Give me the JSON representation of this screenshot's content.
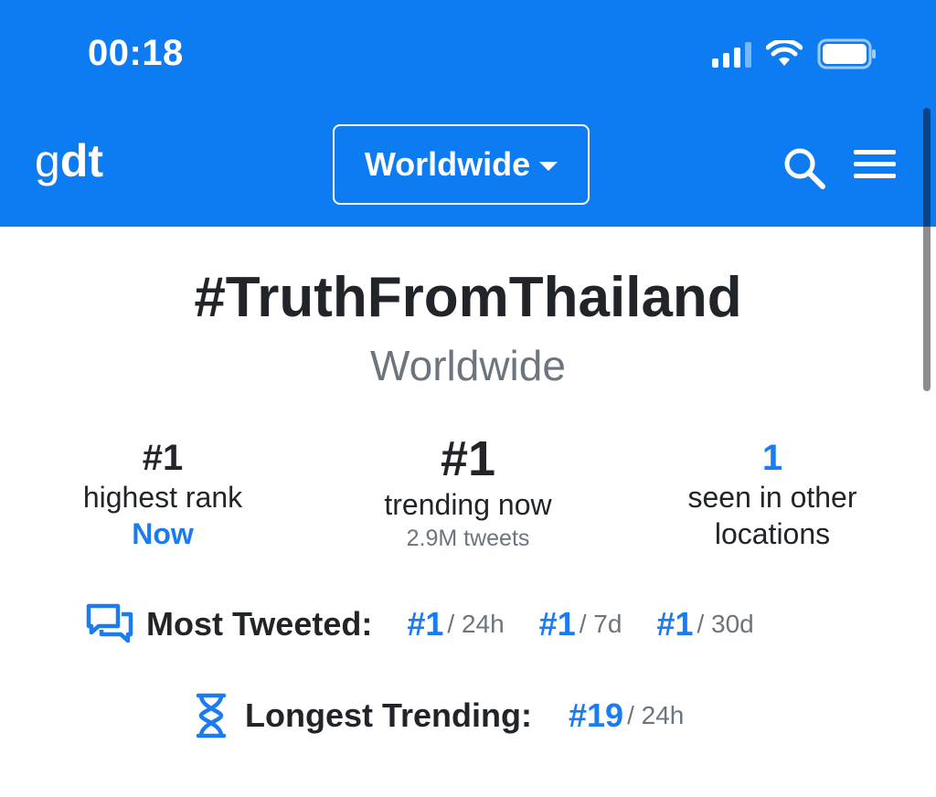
{
  "status_bar": {
    "time": "00:18"
  },
  "navbar": {
    "brand_light": "g",
    "brand_bold": "dt",
    "location_label": "Worldwide",
    "icons": [
      "search-icon",
      "menu-icon",
      "caret-down-icon"
    ]
  },
  "trend": {
    "title": "#TruthFromThailand",
    "location": "Worldwide"
  },
  "stats": {
    "highest_rank": {
      "value": "#1",
      "label": "highest rank",
      "when": "Now"
    },
    "trending_now": {
      "value": "#1",
      "label": "trending now",
      "tweets": "2.9M tweets"
    },
    "other_locations": {
      "value": "1",
      "label_line1": "seen in other",
      "label_line2": "locations"
    }
  },
  "most_tweeted": {
    "heading": "Most Tweeted:",
    "items": [
      {
        "rank": "#1",
        "period": "/ 24h"
      },
      {
        "rank": "#1",
        "period": "/ 7d"
      },
      {
        "rank": "#1",
        "period": "/ 30d"
      }
    ]
  },
  "longest_trending": {
    "heading": "Longest Trending:",
    "items": [
      {
        "rank": "#19",
        "period": "/ 24h"
      }
    ]
  },
  "colors": {
    "header_bg": "#0d7bf2",
    "accent": "#1a7cf0",
    "muted": "#6c757d",
    "text": "#212529"
  }
}
